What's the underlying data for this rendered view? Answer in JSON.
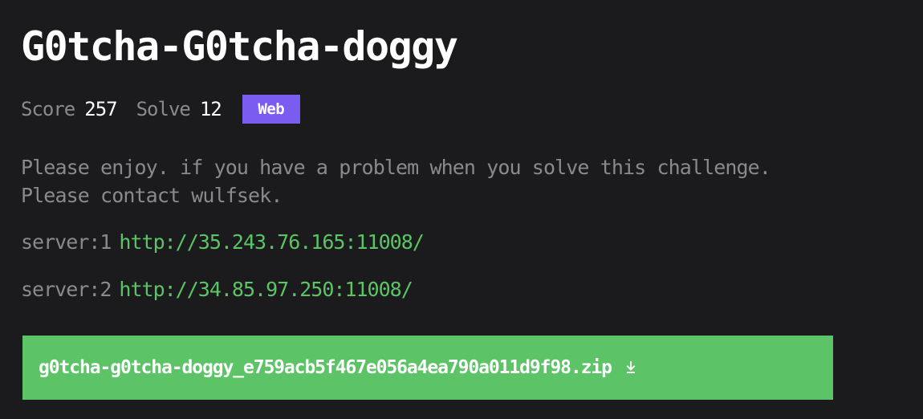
{
  "challenge": {
    "title": "G0tcha-G0tcha-doggy",
    "score_label": "Score",
    "score_value": "257",
    "solve_label": "Solve",
    "solve_value": "12",
    "category": "Web",
    "description": "Please enjoy. if you have a problem when you solve this challenge.\nPlease contact wulfsek.",
    "servers": [
      {
        "label": "server:1",
        "url": "http://35.243.76.165:11008/"
      },
      {
        "label": "server:2",
        "url": "http://34.85.97.250:11008/"
      }
    ],
    "attachment": {
      "filename": "g0tcha-g0tcha-doggy_e759acb5f467e056a4ea790a011d9f98.zip",
      "icon": "download-icon"
    }
  },
  "colors": {
    "background": "#1b1b1d",
    "title": "#ffffff",
    "muted_text": "#8a8a8e",
    "badge_web": "#7a5cf0",
    "link": "#5bc464",
    "download_button": "#5cc466"
  }
}
